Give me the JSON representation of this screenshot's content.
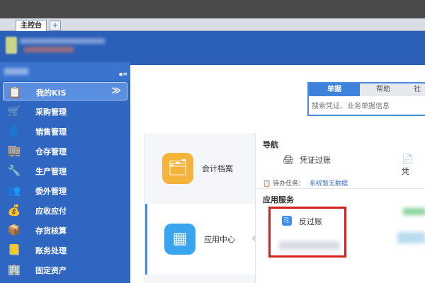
{
  "tabs": {
    "main_tab": "主控台",
    "add_tab": "+"
  },
  "sidebar": {
    "items": [
      {
        "label": "我的KIS",
        "icon": "user-kis-icon",
        "glyph": "📋",
        "active": true,
        "chevron": "≫"
      },
      {
        "label": "采购管理",
        "icon": "purchase-icon",
        "glyph": "🛒"
      },
      {
        "label": "销售管理",
        "icon": "sales-icon",
        "glyph": "👤"
      },
      {
        "label": "仓存管理",
        "icon": "warehouse-icon",
        "glyph": "🏬"
      },
      {
        "label": "生产管理",
        "icon": "production-icon",
        "glyph": "🔧"
      },
      {
        "label": "委外管理",
        "icon": "outsource-icon",
        "glyph": "👥"
      },
      {
        "label": "应收应付",
        "icon": "receivable-icon",
        "glyph": "💰"
      },
      {
        "label": "存货核算",
        "icon": "inventory-icon",
        "glyph": "📦"
      },
      {
        "label": "账务处理",
        "icon": "accounting-icon",
        "glyph": "📒"
      },
      {
        "label": "固定资产",
        "icon": "fixed-asset-icon",
        "glyph": "🏢"
      }
    ]
  },
  "search": {
    "tabs": [
      "单据",
      "帮助",
      "社"
    ],
    "placeholder": "搜索凭证、业务单据信息"
  },
  "cards": {
    "accounting_archive": "会计档案",
    "app_center": "应用中心"
  },
  "content": {
    "nav_title": "导航",
    "nav_item_voucher": "凭证过账",
    "nav_item_partial": "凭",
    "todo_label": "待办任务：",
    "todo_value": "系统暂无数据",
    "app_service_title": "应用服务",
    "reverse_posting": "反过账"
  },
  "colors": {
    "sidebar_bg": "#2f66c2",
    "header_bg": "#2c5fb7",
    "accent": "#3e82dc",
    "highlight_box": "#d41f1f"
  }
}
